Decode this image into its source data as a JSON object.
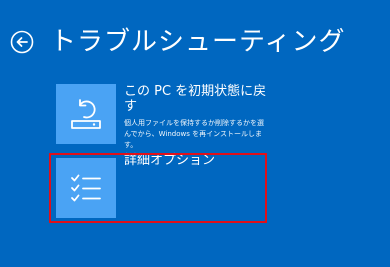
{
  "header": {
    "title": "トラブルシューティング"
  },
  "options": {
    "reset": {
      "title": "この PC を初期状態に戻す",
      "description": "個人用ファイルを保持するか削除するかを選んでから、Windows を再インストールします。",
      "icon": "reset-pc-icon"
    },
    "advanced": {
      "title": "詳細オプション",
      "icon": "checklist-icon"
    }
  },
  "highlight": {
    "color": "#e0101a"
  },
  "colors": {
    "background": "#0067c0",
    "tile": "#4aa3f4"
  }
}
